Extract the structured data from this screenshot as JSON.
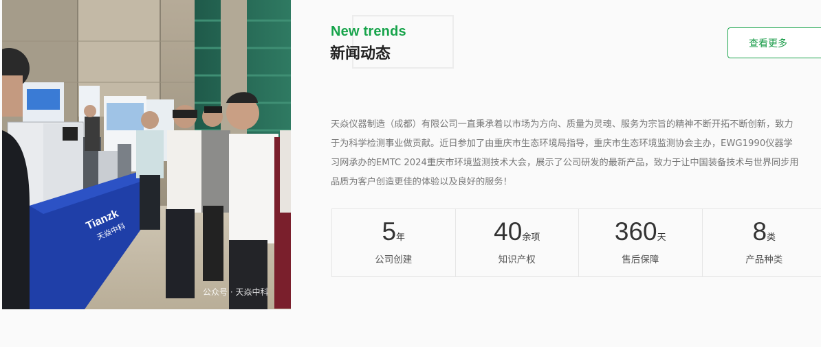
{
  "news": {
    "heading_en": "New trends",
    "heading_cn": "新闻动态",
    "more_label": "查看更多",
    "description_lines": [
      "天焱仪器制造（成都）有限公司一直秉承着以市场为方向、质量为灵魂、服务为宗旨的精神不断开拓不断创新，致力",
      "于为科学检测事业做贡献。近日参加了由重庆市生态环境局指导，重庆市生态环境监测协会主办，EWG1990仪器学",
      "习网承办的EMTC 2024重庆市环境监测技术大会，展示了公司研发的最新产品，致力于让中国装备技术与世界同步用",
      "品质为客户创造更佳的体验以及良好的服务！"
    ],
    "photo": {
      "table_brand": "Tianzk",
      "table_brand_cn": "天焱中科",
      "watermark": "公众号 · 天焱中科"
    }
  },
  "stats": [
    {
      "value": "5",
      "unit": "年",
      "label": "公司创建"
    },
    {
      "value": "40",
      "unit": "余项",
      "label": "知识产权"
    },
    {
      "value": "360",
      "unit": "天",
      "label": "售后保障"
    },
    {
      "value": "8",
      "unit": "类",
      "label": "产品种类"
    }
  ],
  "colors": {
    "accent_green": "#16a34a",
    "table_blue": "#1f3fa8"
  }
}
